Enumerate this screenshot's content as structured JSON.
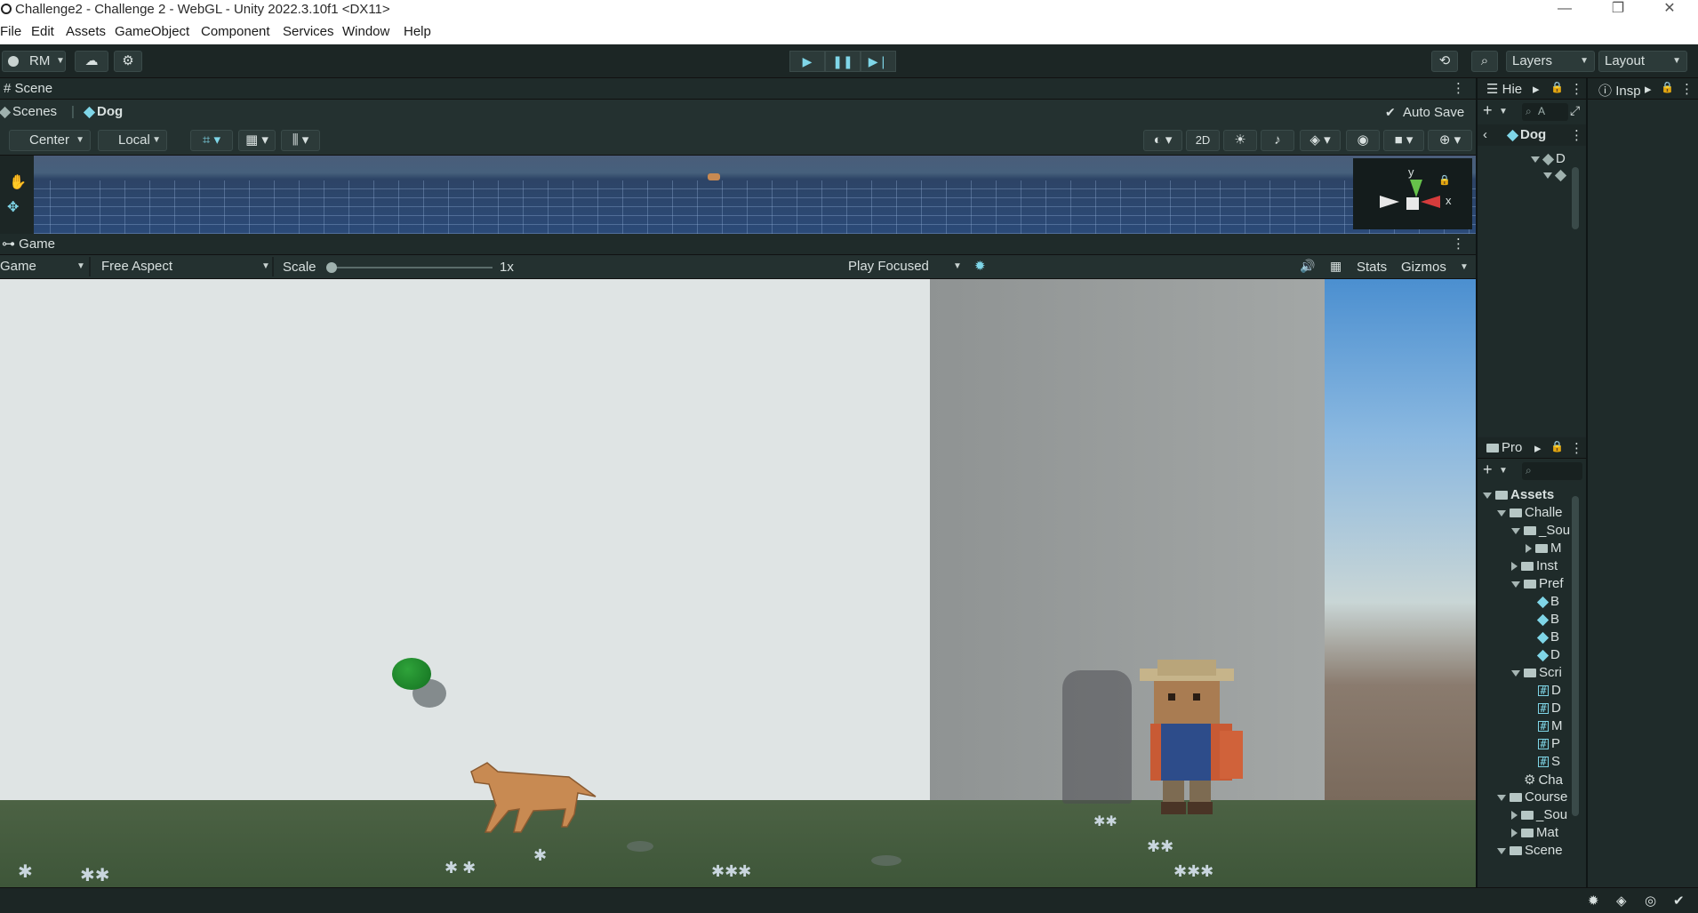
{
  "window": {
    "title": "Challenge2 - Challenge 2 - WebGL - Unity 2022.3.10f1 <DX11>",
    "controls": {
      "minimize": "—",
      "maximize": "❐",
      "close": "✕"
    }
  },
  "menu": [
    "File",
    "Edit",
    "Assets",
    "GameObject",
    "Component",
    "Services",
    "Window",
    "Help"
  ],
  "toolbar": {
    "account": "RM",
    "layers": "Layers",
    "layout": "Layout"
  },
  "scene_panel": {
    "tab": "Scene",
    "breadcrumb_root": "Scenes",
    "breadcrumb_current": "Dog",
    "auto_save": "Auto Save",
    "pivot": "Center",
    "space": "Local",
    "mode_2d": "2D",
    "gizmo_y": "y",
    "gizmo_x": "x"
  },
  "game_panel": {
    "tab": "Game",
    "display": "Game",
    "aspect": "Free Aspect",
    "scale_label": "Scale",
    "scale_value": "1x",
    "play_mode": "Play Focused",
    "stats": "Stats",
    "gizmos": "Gizmos"
  },
  "hierarchy": {
    "tab": "Hie",
    "search_placeholder": "A",
    "root": "Dog",
    "child": "D"
  },
  "inspector": {
    "tab": "Insp"
  },
  "project": {
    "tab": "Pro",
    "items": [
      {
        "label": "Assets",
        "indent": 0,
        "kind": "folder-open",
        "bold": true
      },
      {
        "label": "Challe",
        "indent": 1,
        "kind": "folder-open"
      },
      {
        "label": "_Sou",
        "indent": 2,
        "kind": "folder-open"
      },
      {
        "label": "M",
        "indent": 3,
        "kind": "folder-closed"
      },
      {
        "label": "Inst",
        "indent": 2,
        "kind": "folder-closed"
      },
      {
        "label": "Pref",
        "indent": 2,
        "kind": "folder-open"
      },
      {
        "label": "B",
        "indent": 3,
        "kind": "prefab"
      },
      {
        "label": "B",
        "indent": 3,
        "kind": "prefab"
      },
      {
        "label": "B",
        "indent": 3,
        "kind": "prefab"
      },
      {
        "label": "D",
        "indent": 3,
        "kind": "prefab"
      },
      {
        "label": "Scri",
        "indent": 2,
        "kind": "folder-open"
      },
      {
        "label": "D",
        "indent": 3,
        "kind": "script"
      },
      {
        "label": "D",
        "indent": 3,
        "kind": "script"
      },
      {
        "label": "M",
        "indent": 3,
        "kind": "script"
      },
      {
        "label": "P",
        "indent": 3,
        "kind": "script"
      },
      {
        "label": "S",
        "indent": 3,
        "kind": "script"
      },
      {
        "label": "Cha",
        "indent": 2,
        "kind": "scene"
      },
      {
        "label": "Course",
        "indent": 1,
        "kind": "folder-open"
      },
      {
        "label": "_Sou",
        "indent": 2,
        "kind": "folder-closed"
      },
      {
        "label": "Mat",
        "indent": 2,
        "kind": "folder-closed"
      },
      {
        "label": "Scene",
        "indent": 1,
        "kind": "folder-open"
      }
    ]
  },
  "colors": {
    "accent": "#7fd6e8",
    "panel": "#1f2b2a",
    "ball": "#1e8a2a"
  }
}
